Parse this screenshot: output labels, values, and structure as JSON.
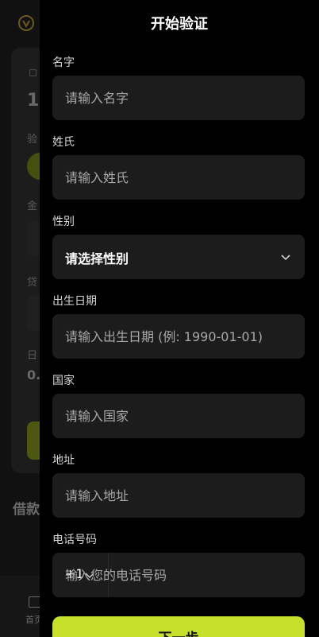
{
  "drawer": {
    "title": "开始验证",
    "fields": [
      {
        "label": "名字",
        "placeholder": "请输入名字"
      },
      {
        "label": "姓氏",
        "placeholder": "请输入姓氏"
      },
      {
        "label": "性别",
        "selected": "请选择性别"
      },
      {
        "label": "出生日期",
        "placeholder": "请输入出生日期 (例: 1990-01-01)"
      },
      {
        "label": "国家",
        "placeholder": "请输入国家"
      },
      {
        "label": "地址",
        "placeholder": "请输入地址"
      },
      {
        "label": "电话号码",
        "country_code": "+1",
        "placeholder": "输入您的电话号码"
      }
    ],
    "next_button": "下一步"
  },
  "background": {
    "section_title": "借款",
    "nav_label": "首页",
    "fragments": [
      "验",
      "金",
      "贷",
      "日"
    ],
    "big_number": "1",
    "small_value": "0."
  },
  "colors": {
    "accent": "#c6e12c",
    "drawer_bg": "#000000",
    "field_bg": "#1c1c1c",
    "placeholder": "#a8a8a8"
  },
  "icons": {
    "select_chevron": "chevron-down-icon",
    "country_chevron": "chevron-down-icon",
    "logo": "shield-logo-icon"
  }
}
